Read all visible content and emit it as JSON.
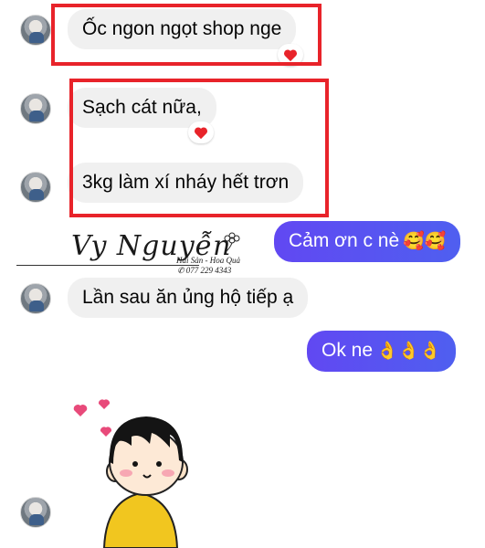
{
  "messages": {
    "m1": {
      "text": "Ốc ngon ngọt shop nge",
      "reaction": "heart"
    },
    "m2": {
      "text": "Sạch cát nữa,",
      "reaction": "heart"
    },
    "m3": {
      "text": "3kg làm xí nháy hết trơn"
    },
    "m4": {
      "text": "Cảm ơn c nè",
      "emoji": "🥰🥰"
    },
    "m5": {
      "text": "Lần sau ăn ủng hộ tiếp ạ"
    },
    "m6": {
      "text": "Ok ne",
      "emoji": "👌👌👌"
    }
  },
  "watermark": {
    "name": "Vy Nguyễn",
    "tagline": "Hải Sản - Hoa Quả",
    "phone": "077 229 4343"
  },
  "sticker": {
    "name": "girl-with-hearts-sticker"
  },
  "colors": {
    "incoming_bubble": "#f0f0f0",
    "outgoing_bubble": "#5b4ef5",
    "highlight": "#e8232a",
    "reaction_heart": "#e8232a"
  }
}
